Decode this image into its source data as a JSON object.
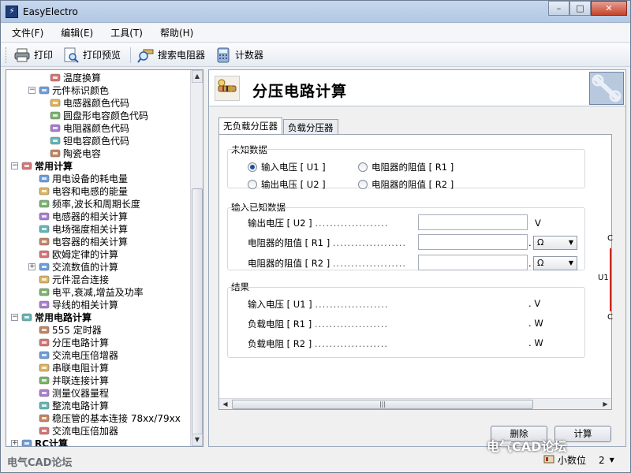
{
  "window": {
    "title": "EasyElectro",
    "app_icon": "app-logo-icon",
    "minimize": "–",
    "maximize": "□",
    "close": "✕"
  },
  "menu": {
    "items": [
      "文件(F)",
      "编辑(E)",
      "工具(T)",
      "帮助(H)"
    ]
  },
  "toolbar": {
    "print": "打印",
    "print_preview": "打印预览",
    "search_resistor": "搜索电阻器",
    "counter": "计数器"
  },
  "tree": {
    "rows": [
      {
        "label": "温度换算",
        "icon": "thermometer-icon",
        "level": 3,
        "bold": false
      },
      {
        "label": "元件标识颜色",
        "icon": "color-chart-icon",
        "level": 2,
        "bold": false,
        "expander": "−"
      },
      {
        "label": "电感器颜色代码",
        "icon": "inductor-icon",
        "level": 3,
        "bold": false
      },
      {
        "label": "圆盘形电容颜色代码",
        "icon": "disc-capacitor-icon",
        "level": 3,
        "bold": false
      },
      {
        "label": "电阻器颜色代码",
        "icon": "resistor-icon",
        "level": 3,
        "bold": false
      },
      {
        "label": "钽电容颜色代码",
        "icon": "tantalum-capacitor-icon",
        "level": 3,
        "bold": false
      },
      {
        "label": "陶瓷电容",
        "icon": "ceramic-capacitor-icon",
        "level": 3,
        "bold": false
      },
      {
        "label": "常用计算",
        "icon": "calc-group-icon",
        "level": 1,
        "bold": true,
        "expander": "−"
      },
      {
        "label": "用电设备的耗电量",
        "icon": "power-plug-icon",
        "level": 2,
        "bold": false
      },
      {
        "label": "电容和电感的能量",
        "icon": "energy-icon",
        "level": 2,
        "bold": false
      },
      {
        "label": "频率,波长和周期长度",
        "icon": "clock-icon",
        "level": 2,
        "bold": false
      },
      {
        "label": "电感器的相关计算",
        "icon": "inductor-calc-icon",
        "level": 2,
        "bold": false
      },
      {
        "label": "电场强度相关计算",
        "icon": "field-icon",
        "level": 2,
        "bold": false
      },
      {
        "label": "电容器的相关计算",
        "icon": "capacitor-calc-icon",
        "level": 2,
        "bold": false
      },
      {
        "label": "欧姆定律的计算",
        "icon": "ohm-icon",
        "level": 2,
        "bold": false
      },
      {
        "label": "交流数值的计算",
        "icon": "ac-icon",
        "level": 2,
        "bold": false,
        "expander": "+"
      },
      {
        "label": "元件混合连接",
        "icon": "network-icon",
        "level": 2,
        "bold": false
      },
      {
        "label": "电平,衰减,增益及功率",
        "icon": "level-icon",
        "level": 2,
        "bold": false
      },
      {
        "label": "导线的相关计算",
        "icon": "wire-icon",
        "level": 2,
        "bold": false
      },
      {
        "label": "常用电路计算",
        "icon": "circuit-group-icon",
        "level": 1,
        "bold": true,
        "expander": "−"
      },
      {
        "label": "555 定时器",
        "icon": "timer-chip-icon",
        "level": 2,
        "bold": false
      },
      {
        "label": "分压电路计算",
        "icon": "divider-icon",
        "level": 2,
        "bold": false
      },
      {
        "label": "交流电压倍增器",
        "icon": "multiplier-icon",
        "level": 2,
        "bold": false
      },
      {
        "label": "串联电阻计算",
        "icon": "series-resistor-icon",
        "level": 2,
        "bold": false
      },
      {
        "label": "并联连接计算",
        "icon": "parallel-icon",
        "level": 2,
        "bold": false
      },
      {
        "label": "测量仪器量程",
        "icon": "meter-icon",
        "level": 2,
        "bold": false
      },
      {
        "label": "整流电路计算",
        "icon": "rectifier-icon",
        "level": 2,
        "bold": false
      },
      {
        "label": "稳压管的基本连接 78xx/79xx",
        "icon": "regulator-icon",
        "level": 2,
        "bold": false
      },
      {
        "label": "交流电压倍加器",
        "icon": "doubler-icon",
        "level": 2,
        "bold": false
      },
      {
        "label": "RC计算",
        "icon": "rc-group-icon",
        "level": 1,
        "bold": true,
        "expander": "+"
      }
    ]
  },
  "panel": {
    "title": "分压电路计算",
    "tabs": [
      "无负载分压器",
      "负载分压器"
    ],
    "unknown": {
      "title": "未知数据",
      "options": [
        "输入电压 [ U1 ]",
        "电阻器的阻值 [ R1 ]",
        "输出电压 [ U2 ]",
        "电阻器的阻值 [ R2 ]"
      ],
      "selected": "输入电压 [ U1 ]"
    },
    "known": {
      "title": "输入已知数据",
      "rows": [
        {
          "label": "输出电压 [ U2 ]",
          "unit": "V",
          "value": ""
        },
        {
          "label": "电阻器的阻值 [ R1 ]",
          "unit": "",
          "value": "",
          "select": "Ω"
        },
        {
          "label": "电阻器的阻值 [ R2 ]",
          "unit": "",
          "value": "",
          "select": "Ω"
        }
      ]
    },
    "result": {
      "title": "结果",
      "rows": [
        {
          "label": "输入电压 [ U1 ]",
          "unit": "V"
        },
        {
          "label": "负载电阻 [ R1 ]",
          "unit": "W"
        },
        {
          "label": "负载电阻 [ R2 ]",
          "unit": "W"
        }
      ]
    },
    "dots": "....................",
    "hscroll_grip": "|||",
    "diagram_labels": {
      "c_top": "C",
      "u1": "U1",
      "c_bottom": "C"
    }
  },
  "buttons": {
    "delete": "删除",
    "calculate": "计算"
  },
  "status": {
    "decimal_label": "小数位",
    "decimal_value": "2"
  },
  "watermarks": {
    "left": "电气CAD论坛",
    "right": "电气CAD论坛"
  }
}
